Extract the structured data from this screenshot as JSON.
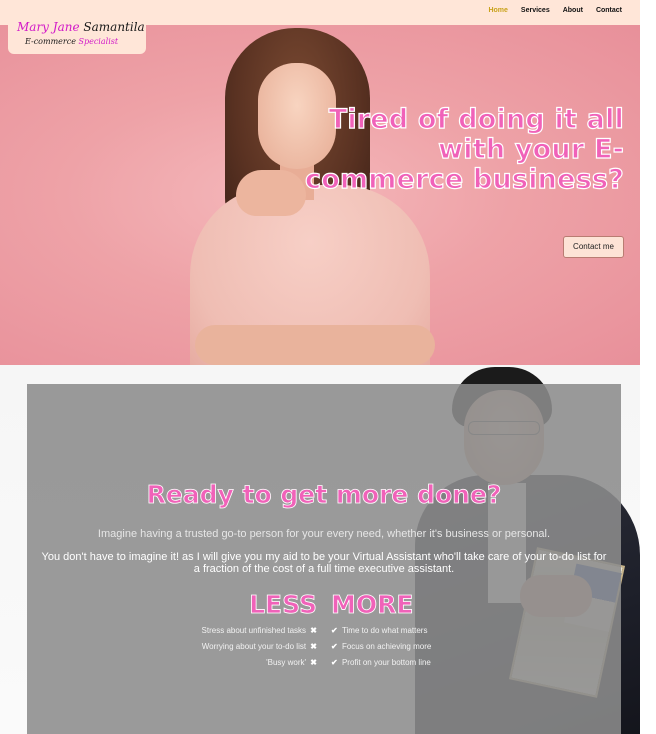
{
  "logo": {
    "first": "Mary Jane",
    "last": "Samantila",
    "subtitle_dark": "E-commerce",
    "subtitle_pink": "Specialist"
  },
  "nav": {
    "links": [
      {
        "label": "Home",
        "active": true
      },
      {
        "label": "Services",
        "active": false
      },
      {
        "label": "About",
        "active": false
      },
      {
        "label": "Contact",
        "active": false
      }
    ]
  },
  "hero": {
    "headline": "Tired of doing it all with your E-commerce business?",
    "cta_label": "Contact me"
  },
  "section2": {
    "heading": "Ready to get more done?",
    "paragraph1": "Imagine having a trusted go-to person for your every need, whether it's business or personal.",
    "paragraph2": "You don't have to imagine it! as I will give you my aid to be your Virtual Assistant who'll take care of your to-do list for a fraction of the cost of a full time executive assistant.",
    "less": {
      "title": "LESS",
      "items": [
        "Stress about unfinished tasks",
        "Worrying about your to-do list",
        "'Busy work'"
      ]
    },
    "more": {
      "title": "MORE",
      "items": [
        "Time to do what matters",
        "Focus on achieving more",
        "Profit on your bottom line"
      ]
    }
  },
  "colors": {
    "accent_pink": "#f062b9",
    "nav_bg": "#ffe6d8",
    "nav_active": "#c9a21a",
    "hero_bg": "#eea2a7",
    "panel_bg": "#8c8c8c"
  },
  "icons": {
    "less_marker": "times-icon",
    "more_marker": "check-icon"
  }
}
